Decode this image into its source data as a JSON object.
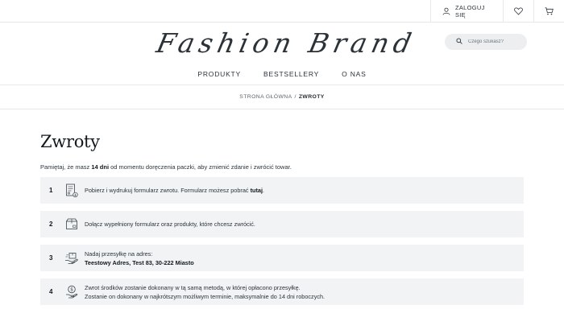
{
  "topbar": {
    "login_label": "ZALOGUJ SIĘ",
    "icons": [
      "user-icon",
      "heart-icon",
      "cart-icon"
    ]
  },
  "brand": {
    "logo_text": "Fashion Brand"
  },
  "search": {
    "placeholder": "Czego szukasz?"
  },
  "nav": {
    "items": [
      {
        "label": "PRODUKTY"
      },
      {
        "label": "BESTSELLERY"
      },
      {
        "label": "O NAS"
      }
    ]
  },
  "breadcrumb": {
    "home": "STRONA GŁÓWNA",
    "separator": "/",
    "current": "ZWROTY"
  },
  "page": {
    "title": "Zwroty",
    "intro_before": "Pamiętaj, że masz ",
    "intro_bold": "14 dni",
    "intro_after": " od momentu doręczenia paczki, aby zmienić zdanie i zwrócić towar."
  },
  "steps": [
    {
      "num": "1",
      "icon": "form-document-icon",
      "line1": "Pobierz i wydrukuj formularz zwrotu. Formularz możesz pobrać ",
      "link": "tutaj",
      "line1_end": "."
    },
    {
      "num": "2",
      "icon": "package-box-icon",
      "line1": "Dołącz wypełniony formularz oraz produkty, które chcesz zwrócić."
    },
    {
      "num": "3",
      "icon": "shipping-hand-icon",
      "line1": "Nadaj przesyłkę na adres:",
      "line2": "Teestowy Adres, Test 83, 30-222 Miasto"
    },
    {
      "num": "4",
      "icon": "money-refund-icon",
      "line1": "Zwrot środków zostanie dokonany w tą samą metodą, w której opłacono przesyłkę.",
      "line2": "Zostanie on dokonany w najkrótszym możliwym terminie, maksymalnie do 14 dni roboczych."
    }
  ],
  "colors": {
    "text": "#1f2a33",
    "step_bg": "#f2f3f5",
    "border": "#e6e8ea",
    "search_bg": "#eceef0"
  }
}
